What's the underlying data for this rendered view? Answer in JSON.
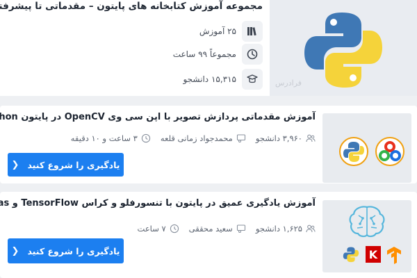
{
  "collection": {
    "title": "مجموعه آموزش کتابخانه های پایتون – مقدماتی تا پیشرفته",
    "course_count": "۲۵ آموزش",
    "total_hours": "مجموعاً ۹۹ ساعت",
    "students": "۱۵,۳۱۵ دانشجو",
    "watermark": "فرادرس",
    "icons": [
      "books-icon",
      "clock-icon",
      "graduate-icon",
      "python-logo"
    ]
  },
  "courses": [
    {
      "title": "آموزش مقدماتی پردازش تصویر با اپن سی وی OpenCV در پایتون Python",
      "students": "۳,۹۶۰ دانشجو",
      "instructor": "محمدجواد زمانی قلعه",
      "duration": "۳ ساعت و ۱۰ دقیقه",
      "button_label": "یادگیری را شروع کنید",
      "logos": [
        "python-logo",
        "opencv-logo"
      ]
    },
    {
      "title": "آموزش یادگیری عمیق در پایتون با تنسورفلو و کراس TensorFlow و Keras",
      "students": "۱,۶۲۵ دانشجو",
      "instructor": "سعید محققی",
      "duration": "۷ ساعت",
      "button_label": "یادگیری را شروع کنید",
      "logos": [
        "brain-icon",
        "python-logo",
        "keras-logo",
        "tensorflow-logo"
      ]
    }
  ],
  "colors": {
    "accent": "#1c7ff0",
    "python_blue": "#3f78b5",
    "python_yellow": "#f5d33a",
    "keras_red": "#d00000",
    "tensorflow_orange": "#ff8f00"
  }
}
